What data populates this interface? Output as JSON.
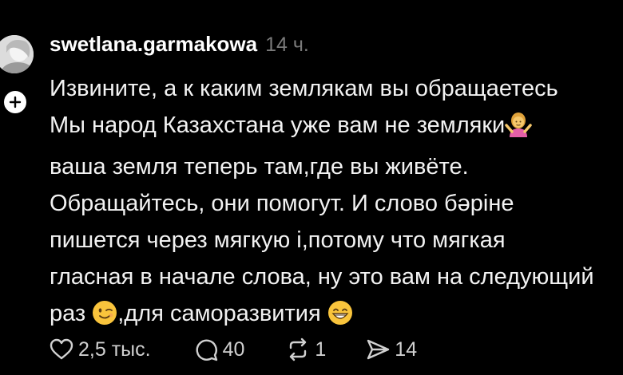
{
  "post": {
    "author": "swetlana.garmakowa",
    "time": "14 ч.",
    "lines": [
      "Извините, а к каким землякам вы обращаетесь",
      "Мы народ Казахстана уже вам не земляки",
      "ваша земля теперь там,где вы живёте.",
      "Обращайтесь, они помогут. И слово бәріне",
      "пишется через мягкую і,потому что мягкая",
      "гласная в начале слова, ну это вам на следующий",
      "раз ",
      ",для саморазвития "
    ],
    "emojis": [
      "person-shrugging-emoji",
      "winking-face-emoji",
      "grinning-face-emoji"
    ]
  },
  "actions": {
    "likes": "2,5 тыс.",
    "replies": "40",
    "reposts": "1",
    "shares": "14"
  },
  "colors": {
    "background": "#000000",
    "text": "#f2f2f2",
    "muted": "#7a7a7a",
    "action": "#d0d0d0"
  }
}
